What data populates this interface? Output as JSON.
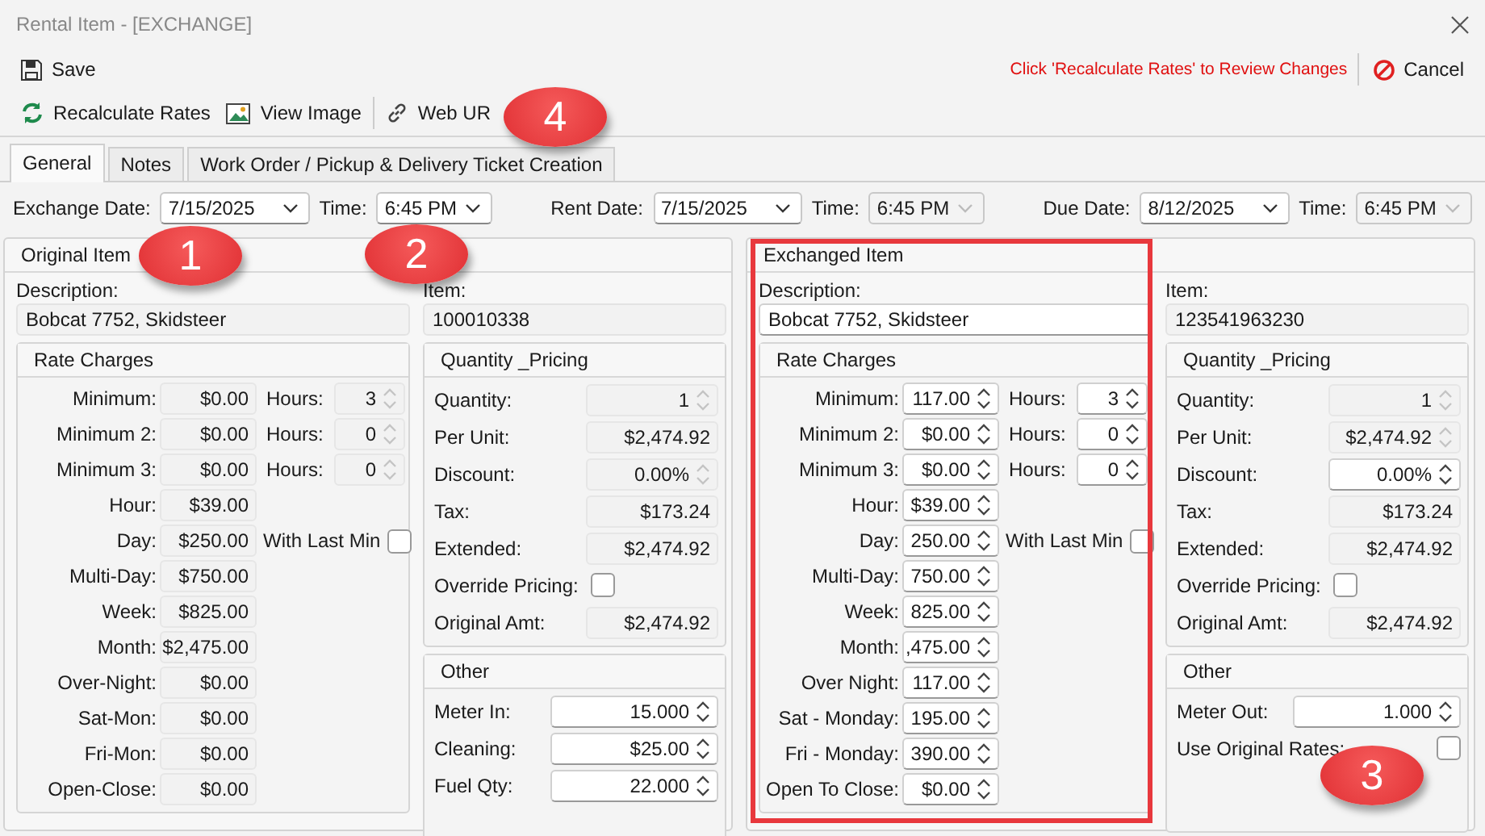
{
  "window": {
    "title": "Rental Item - [EXCHANGE]"
  },
  "toolbar": {
    "save": "Save",
    "notice": "Click 'Recalculate Rates' to Review Changes",
    "cancel": "Cancel"
  },
  "actions": [
    {
      "label": "Recalculate Rates",
      "kind": "refresh"
    },
    {
      "label": "View Image",
      "kind": "image"
    },
    {
      "label": "Web UR",
      "kind": "link"
    }
  ],
  "tabs": [
    {
      "label": "General",
      "selected": true
    },
    {
      "label": "Notes",
      "selected": false
    },
    {
      "label": "Work Order / Pickup & Delivery Ticket Creation",
      "selected": false
    }
  ],
  "dates": [
    {
      "label": "Exchange Date:",
      "value": "7/15/2025",
      "kind": "date",
      "disabled": false
    },
    {
      "label": "Time:",
      "value": "6:45 PM",
      "kind": "time",
      "disabled": false
    },
    {
      "label": "Rent Date:",
      "value": "7/15/2025",
      "kind": "date",
      "disabled": false
    },
    {
      "label": "Time:",
      "value": "6:45 PM",
      "kind": "time",
      "disabled": true
    },
    {
      "label": "Due Date:",
      "value": "8/12/2025",
      "kind": "date",
      "disabled": false
    },
    {
      "label": "Time:",
      "value": "6:45 PM",
      "kind": "time",
      "disabled": true
    }
  ],
  "panels": [
    {
      "title": "Original Item",
      "highlighted": false,
      "description": {
        "label": "Description:",
        "value": "Bobcat 7752, Skidsteer",
        "editable": false
      },
      "item": {
        "label": "Item:",
        "value": "100010338",
        "editable": false
      },
      "rates": {
        "title": "Rate Charges",
        "rows": [
          {
            "label": "Minimum:",
            "value": "$0.00",
            "editable": false,
            "spinner": false,
            "extra": {
              "kind": "hours",
              "label": "Hours:",
              "value": "3",
              "editable": false,
              "spinner": true
            }
          },
          {
            "label": "Minimum 2:",
            "value": "$0.00",
            "editable": false,
            "spinner": false,
            "extra": {
              "kind": "hours",
              "label": "Hours:",
              "value": "0",
              "editable": false,
              "spinner": true
            }
          },
          {
            "label": "Minimum 3:",
            "value": "$0.00",
            "editable": false,
            "spinner": false,
            "extra": {
              "kind": "hours",
              "label": "Hours:",
              "value": "0",
              "editable": false,
              "spinner": true
            }
          },
          {
            "label": "Hour:",
            "value": "$39.00",
            "editable": false,
            "spinner": false
          },
          {
            "label": "Day:",
            "value": "$250.00",
            "editable": false,
            "spinner": false,
            "extra": {
              "kind": "checkbox",
              "label": "With Last Min",
              "checked": false
            }
          },
          {
            "label": "Multi-Day:",
            "value": "$750.00",
            "editable": false,
            "spinner": false
          },
          {
            "label": "Week:",
            "value": "$825.00",
            "editable": false,
            "spinner": false
          },
          {
            "label": "Month:",
            "value": "$2,475.00",
            "editable": false,
            "spinner": false
          },
          {
            "label": "Over-Night:",
            "value": "$0.00",
            "editable": false,
            "spinner": false
          },
          {
            "label": "Sat-Mon:",
            "value": "$0.00",
            "editable": false,
            "spinner": false
          },
          {
            "label": "Fri-Mon:",
            "value": "$0.00",
            "editable": false,
            "spinner": false
          },
          {
            "label": "Open-Close:",
            "value": "$0.00",
            "editable": false,
            "spinner": false
          }
        ]
      },
      "pricing": {
        "title": "Quantity _Pricing",
        "rows": [
          {
            "kind": "field",
            "label": "Quantity:",
            "value": "1",
            "editable": false,
            "spinner": true
          },
          {
            "kind": "field",
            "label": "Per Unit:",
            "value": "$2,474.92",
            "editable": false,
            "spinner": false
          },
          {
            "kind": "field",
            "label": "Discount:",
            "value": "0.00%",
            "editable": false,
            "spinner": true
          },
          {
            "kind": "field",
            "label": "Tax:",
            "value": "$173.24",
            "editable": false,
            "spinner": false
          },
          {
            "kind": "field",
            "label": "Extended:",
            "value": "$2,474.92",
            "editable": false,
            "spinner": false
          },
          {
            "kind": "checkbox",
            "label": "Override Pricing:",
            "checked": false
          },
          {
            "kind": "field",
            "label": "Original Amt:",
            "value": "$2,474.92",
            "editable": false,
            "spinner": false
          }
        ]
      },
      "other": {
        "title": "Other",
        "rows": [
          {
            "kind": "field",
            "label": "Meter In:",
            "value": "15.000",
            "editable": true,
            "spinner": true
          },
          {
            "kind": "field",
            "label": "Cleaning:",
            "value": "$25.00",
            "editable": true,
            "spinner": true
          },
          {
            "kind": "field",
            "label": "Fuel Qty:",
            "value": "22.000",
            "editable": true,
            "spinner": true
          }
        ]
      }
    },
    {
      "title": "Exchanged Item",
      "highlighted": true,
      "description": {
        "label": "Description:",
        "value": "Bobcat 7752, Skidsteer",
        "editable": true
      },
      "item": {
        "label": "Item:",
        "value": "123541963230",
        "editable": false
      },
      "rates": {
        "title": "Rate Charges",
        "rows": [
          {
            "label": "Minimum:",
            "value": "117.00",
            "editable": true,
            "spinner": true,
            "extra": {
              "kind": "hours",
              "label": "Hours:",
              "value": "3",
              "editable": true,
              "spinner": true
            }
          },
          {
            "label": "Minimum 2:",
            "value": "$0.00",
            "editable": true,
            "spinner": true,
            "extra": {
              "kind": "hours",
              "label": "Hours:",
              "value": "0",
              "editable": true,
              "spinner": true
            }
          },
          {
            "label": "Minimum 3:",
            "value": "$0.00",
            "editable": true,
            "spinner": true,
            "extra": {
              "kind": "hours",
              "label": "Hours:",
              "value": "0",
              "editable": true,
              "spinner": true
            }
          },
          {
            "label": "Hour:",
            "value": "$39.00",
            "editable": true,
            "spinner": true
          },
          {
            "label": "Day:",
            "value": "250.00",
            "editable": true,
            "spinner": true,
            "extra": {
              "kind": "checkbox",
              "label": "With Last Min",
              "checked": false
            }
          },
          {
            "label": "Multi-Day:",
            "value": "750.00",
            "editable": true,
            "spinner": true
          },
          {
            "label": "Week:",
            "value": "825.00",
            "editable": true,
            "spinner": true
          },
          {
            "label": "Month:",
            "value": ",475.00",
            "editable": true,
            "spinner": true
          },
          {
            "label": "Over Night:",
            "value": "117.00",
            "editable": true,
            "spinner": true
          },
          {
            "label": "Sat - Monday:",
            "value": "195.00",
            "editable": true,
            "spinner": true
          },
          {
            "label": "Fri - Monday:",
            "value": "390.00",
            "editable": true,
            "spinner": true
          },
          {
            "label": "Open To Close:",
            "value": "$0.00",
            "editable": true,
            "spinner": true
          }
        ]
      },
      "pricing": {
        "title": "Quantity _Pricing",
        "rows": [
          {
            "kind": "field",
            "label": "Quantity:",
            "value": "1",
            "editable": false,
            "spinner": true
          },
          {
            "kind": "field",
            "label": "Per Unit:",
            "value": "$2,474.92",
            "editable": false,
            "spinner": true
          },
          {
            "kind": "field",
            "label": "Discount:",
            "value": "0.00%",
            "editable": true,
            "spinner": true
          },
          {
            "kind": "field",
            "label": "Tax:",
            "value": "$173.24",
            "editable": false,
            "spinner": false
          },
          {
            "kind": "field",
            "label": "Extended:",
            "value": "$2,474.92",
            "editable": false,
            "spinner": false
          },
          {
            "kind": "checkbox",
            "label": "Override Pricing:",
            "checked": false
          },
          {
            "kind": "field",
            "label": "Original Amt:",
            "value": "$2,474.92",
            "editable": false,
            "spinner": false
          }
        ]
      },
      "other": {
        "title": "Other",
        "rows": [
          {
            "kind": "field",
            "label": "Meter Out:",
            "value": "1.000",
            "editable": true,
            "spinner": true
          },
          {
            "kind": "checkbox",
            "label": "Use Original Rates:",
            "checked": false
          }
        ]
      }
    }
  ],
  "callouts": [
    {
      "label": "1"
    },
    {
      "label": "2"
    },
    {
      "label": "3"
    },
    {
      "label": "4"
    }
  ]
}
